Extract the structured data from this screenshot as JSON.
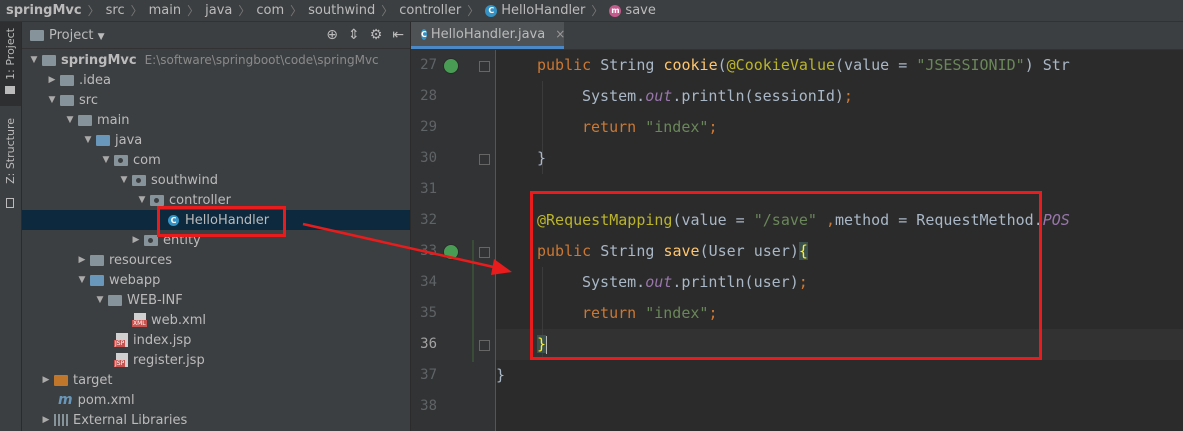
{
  "breadcrumb": [
    {
      "label": "springMvc",
      "icon": "folder-icon"
    },
    {
      "label": "src",
      "icon": "folder-icon"
    },
    {
      "label": "main",
      "icon": "folder-icon"
    },
    {
      "label": "java",
      "icon": "folder-icon"
    },
    {
      "label": "com",
      "icon": "package-icon"
    },
    {
      "label": "southwind",
      "icon": "package-icon"
    },
    {
      "label": "controller",
      "icon": "package-icon"
    },
    {
      "label": "HelloHandler",
      "icon": "class-icon"
    },
    {
      "label": "save",
      "icon": "method-icon"
    }
  ],
  "class_glyph": "C",
  "method_glyph": "m",
  "side_tabs": [
    {
      "label": "1: Project"
    },
    {
      "label": "Z: Structure"
    }
  ],
  "project_panel": {
    "title": "Project"
  },
  "tree": [
    {
      "label": "springMvc",
      "path": "E:\\software\\springboot\\code\\springMvc",
      "bold": true
    },
    {
      "label": ".idea"
    },
    {
      "label": "src"
    },
    {
      "label": "main"
    },
    {
      "label": "java"
    },
    {
      "label": "com"
    },
    {
      "label": "southwind"
    },
    {
      "label": "controller"
    },
    {
      "label": "HelloHandler",
      "selected": true
    },
    {
      "label": "entity"
    },
    {
      "label": "resources"
    },
    {
      "label": "webapp"
    },
    {
      "label": "WEB-INF"
    },
    {
      "label": "web.xml"
    },
    {
      "label": "index.jsp"
    },
    {
      "label": "register.jsp"
    },
    {
      "label": "target"
    },
    {
      "label": "pom.xml"
    },
    {
      "label": "External Libraries"
    }
  ],
  "file_badges": {
    "xml": "XML",
    "jsp": "JSP"
  },
  "editor": {
    "tab_label": "HelloHandler.java",
    "tab_close": "×",
    "line_numbers": [
      "27",
      "28",
      "29",
      "30",
      "31",
      "32",
      "33",
      "34",
      "35",
      "36",
      "37",
      "38"
    ],
    "lines": {
      "l27": {
        "kw1": "public",
        "t1": " String ",
        "fn": "cookie",
        "t2": "(",
        "ann": "@CookieValue",
        "t3": "(value = ",
        "str": "\"JSESSIONID\"",
        "t4": ") Str"
      },
      "l28": {
        "t1": "System.",
        "field": "out",
        "t2": ".println(sessionId)",
        "semi": ";"
      },
      "l29": {
        "kw": "return ",
        "str": "\"index\"",
        "semi": ";"
      },
      "l30": {
        "t": "}"
      },
      "l32": {
        "ann": "@RequestMapping",
        "t1": "(value = ",
        "str": "\"/save\"",
        "t2": " ,",
        "t3": "method = RequestMethod.",
        "c": "POS"
      },
      "l33": {
        "kw1": "public",
        "t1": " String ",
        "fn": "save",
        "t2": "(User user)",
        "brace": "{"
      },
      "l34": {
        "t1": "System.",
        "field": "out",
        "t2": ".println(user)",
        "semi": ";"
      },
      "l35": {
        "kw": "return ",
        "str": "\"index\"",
        "semi": ";"
      },
      "l36": {
        "brace": "}"
      },
      "l37": {
        "t": "}"
      }
    }
  },
  "colors": {
    "highlight": "#e81c1c",
    "accent": "#4a88c7"
  }
}
